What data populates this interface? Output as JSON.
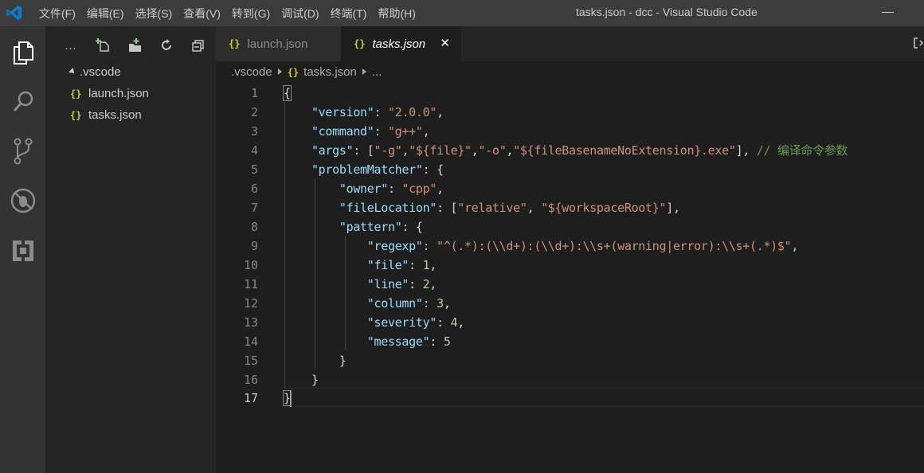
{
  "titlebar": {
    "menus": [
      "文件(F)",
      "编辑(E)",
      "选择(S)",
      "查看(V)",
      "转到(G)",
      "调试(D)",
      "终端(T)",
      "帮助(H)"
    ],
    "window_title": "tasks.json - dcc - Visual Studio Code"
  },
  "activity_icons": [
    "explorer-icon",
    "search-icon",
    "source-control-icon",
    "debug-icon",
    "extensions-icon"
  ],
  "sidebar": {
    "more": "...",
    "folder": ".vscode",
    "files": [
      "launch.json",
      "tasks.json"
    ],
    "json_icon": "{}"
  },
  "tabs": [
    {
      "label": "launch.json",
      "icon": "{}"
    },
    {
      "label": "tasks.json",
      "icon": "{}",
      "close": "✕"
    }
  ],
  "breadcrumb": {
    "folder": ".vscode",
    "file": "tasks.json",
    "more": "..."
  },
  "line_numbers": [
    "1",
    "2",
    "3",
    "4",
    "5",
    "6",
    "7",
    "8",
    "9",
    "10",
    "11",
    "12",
    "13",
    "14",
    "15",
    "16",
    "17"
  ],
  "code": {
    "l1_open": "{",
    "version_key": "\"version\"",
    "version_val": "\"2.0.0\"",
    "command_key": "\"command\"",
    "command_val": "\"g++\"",
    "args_key": "\"args\"",
    "args_0": "\"-g\"",
    "args_1": "\"${file}\"",
    "args_2": "\"-o\"",
    "args_3": "\"${fileBasenameNoExtension}.exe\"",
    "args_comment": "// 编译命令参数",
    "pm_key": "\"problemMatcher\"",
    "owner_key": "\"owner\"",
    "owner_val": "\"cpp\"",
    "fl_key": "\"fileLocation\"",
    "fl_0": "\"relative\"",
    "fl_1": "\"${workspaceRoot}\"",
    "pattern_key": "\"pattern\"",
    "regexp_key": "\"regexp\"",
    "regexp_val": "\"^(.*):(\\\\d+):(\\\\d+):\\\\s+(warning|error):\\\\s+(.*)$\"",
    "file_key": "\"file\"",
    "file_val": "1",
    "line_key": "\"line\"",
    "line_val": "2",
    "column_key": "\"column\"",
    "column_val": "3",
    "severity_key": "\"severity\"",
    "severity_val": "4",
    "message_key": "\"message\"",
    "message_val": "5",
    "close_brace": "}"
  },
  "colors": {
    "key": "#9cdcfe",
    "string": "#ce9178",
    "number": "#b5cea8",
    "comment": "#6a9955",
    "json_icon": "#cbcb41"
  }
}
